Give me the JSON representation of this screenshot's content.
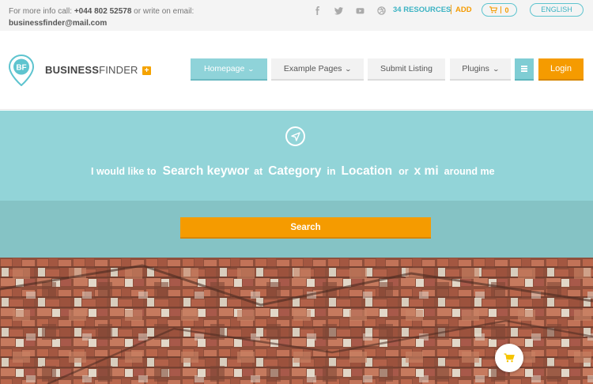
{
  "topbar": {
    "info_prefix": "For more info call:",
    "phone": "+044 802 52578",
    "info_mid": "or write on email:",
    "email": "businessfinder@mail.com",
    "resources_label": "34 RESOURCES",
    "add_label": "ADD",
    "cart_count": "0",
    "language": "ENGLISH"
  },
  "logo": {
    "bold": "BUSINESS",
    "light": "FINDER",
    "initials": "BF"
  },
  "nav": {
    "items": [
      {
        "label": "Homepage",
        "has_dropdown": true,
        "active": true
      },
      {
        "label": "Example Pages",
        "has_dropdown": true
      },
      {
        "label": "Submit Listing",
        "has_dropdown": false
      },
      {
        "label": "Plugins",
        "has_dropdown": true
      }
    ],
    "login_label": "Login"
  },
  "search": {
    "phrase_start": "I would like to",
    "keyword_placeholder": "Search keywor",
    "word_at": "at",
    "category_placeholder": "Category",
    "word_in": "in",
    "location_placeholder": "Location",
    "word_or": "or",
    "radius_placeholder": "x mi",
    "phrase_end": "around me",
    "button_label": "Search"
  },
  "colors": {
    "accent_teal": "#92d4d8",
    "accent_orange": "#f59b00",
    "link_teal": "#3cb3c3"
  },
  "icons": [
    "facebook-icon",
    "twitter-icon",
    "youtube-icon",
    "dribbble-icon",
    "cart-icon",
    "compass-icon",
    "menu-icon"
  ]
}
